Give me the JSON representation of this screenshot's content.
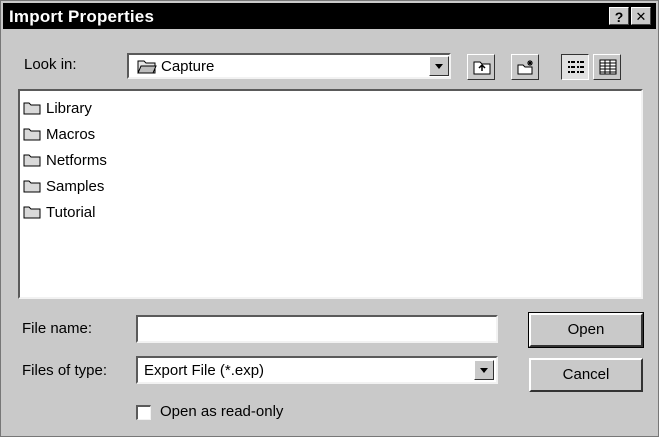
{
  "window": {
    "title": "Import Properties",
    "help_glyph": "?",
    "close_glyph": "✕"
  },
  "look_in": {
    "label": "Look in:",
    "value": "Capture",
    "icon": "open-folder-icon"
  },
  "toolbar": {
    "buttons": [
      {
        "name": "up-one-level",
        "icon": "up-folder-icon"
      },
      {
        "name": "create-new-folder",
        "icon": "new-folder-icon"
      },
      {
        "name": "list-view",
        "icon": "list-view-icon",
        "pressed": true
      },
      {
        "name": "details-view",
        "icon": "details-view-icon"
      }
    ]
  },
  "file_list": {
    "items": [
      {
        "label": "Library",
        "icon": "folder-icon"
      },
      {
        "label": "Macros",
        "icon": "folder-icon"
      },
      {
        "label": "Netforms",
        "icon": "folder-icon"
      },
      {
        "label": "Samples",
        "icon": "folder-icon"
      },
      {
        "label": "Tutorial",
        "icon": "folder-icon"
      }
    ]
  },
  "file_name": {
    "label": "File name:",
    "value": ""
  },
  "files_of_type": {
    "label": "Files of type:",
    "value": "Export File (*.exp)"
  },
  "read_only": {
    "label": "Open as read-only",
    "checked": false
  },
  "buttons": {
    "open": "Open",
    "cancel": "Cancel"
  }
}
